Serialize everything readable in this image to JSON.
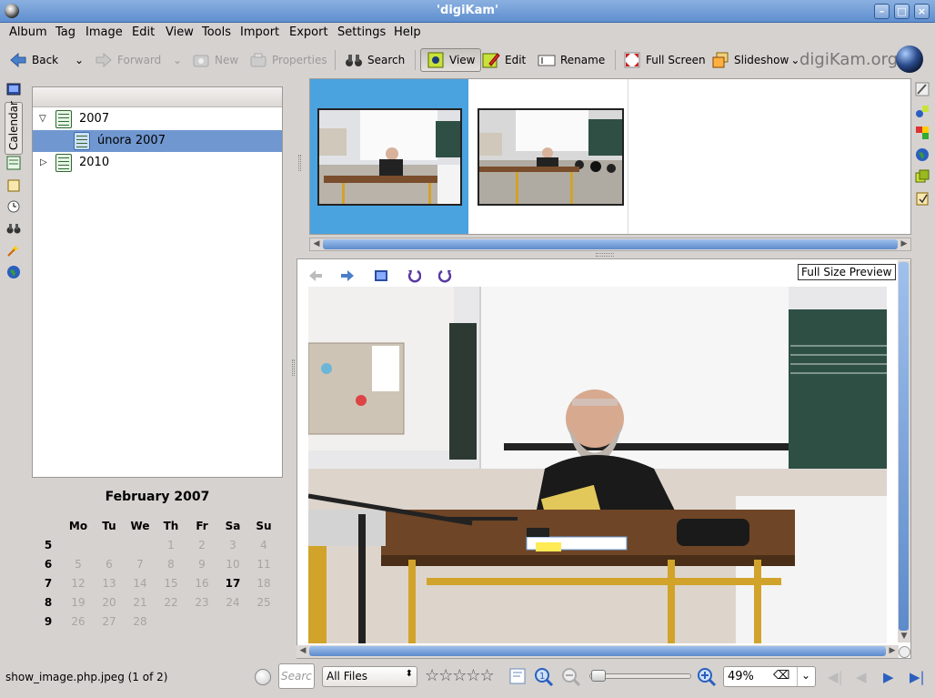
{
  "window": {
    "title": "'digiKam'"
  },
  "menu": [
    "Album",
    "Tag",
    "Image",
    "Edit",
    "View",
    "Tools",
    "Import",
    "Export",
    "Settings",
    "Help"
  ],
  "toolbar": {
    "back": "Back",
    "forward": "Forward",
    "new": "New",
    "properties": "Properties",
    "search": "Search",
    "view": "View",
    "edit": "Edit",
    "rename": "Rename",
    "fullscreen": "Full Screen",
    "slideshow": "Slideshow",
    "brand": "digiKam.org"
  },
  "sidebar": {
    "calendar_tab": "Calendar"
  },
  "tree": [
    {
      "label": "2007",
      "expanded": true
    },
    {
      "label": "února 2007",
      "selected": true
    },
    {
      "label": "2010",
      "expanded": false
    }
  ],
  "calendar": {
    "title": "February 2007",
    "days": [
      "Mo",
      "Tu",
      "We",
      "Th",
      "Fr",
      "Sa",
      "Su"
    ],
    "weeks": [
      {
        "week": "5",
        "cells": [
          "",
          "",
          "",
          "1",
          "2",
          "3",
          "4"
        ]
      },
      {
        "week": "6",
        "cells": [
          "5",
          "6",
          "7",
          "8",
          "9",
          "10",
          "11"
        ]
      },
      {
        "week": "7",
        "cells": [
          "12",
          "13",
          "14",
          "15",
          "16",
          "17",
          "18"
        ]
      },
      {
        "week": "8",
        "cells": [
          "19",
          "20",
          "21",
          "22",
          "23",
          "24",
          "25"
        ]
      },
      {
        "week": "9",
        "cells": [
          "26",
          "27",
          "28",
          "",
          "",
          "",
          ""
        ]
      }
    ],
    "highlight_day": "17"
  },
  "preview": {
    "full_size_label": "Full Size Preview"
  },
  "status": {
    "text": "show_image.php.jpeg (1 of 2)",
    "search_placeholder": "Searc",
    "filter": "All Files",
    "rating": "☆☆☆☆☆",
    "zoom": "49%"
  },
  "colors": {
    "selection": "#4aa3df",
    "tree_selection": "#7097d0",
    "titlebar": "#6f9bd6"
  }
}
